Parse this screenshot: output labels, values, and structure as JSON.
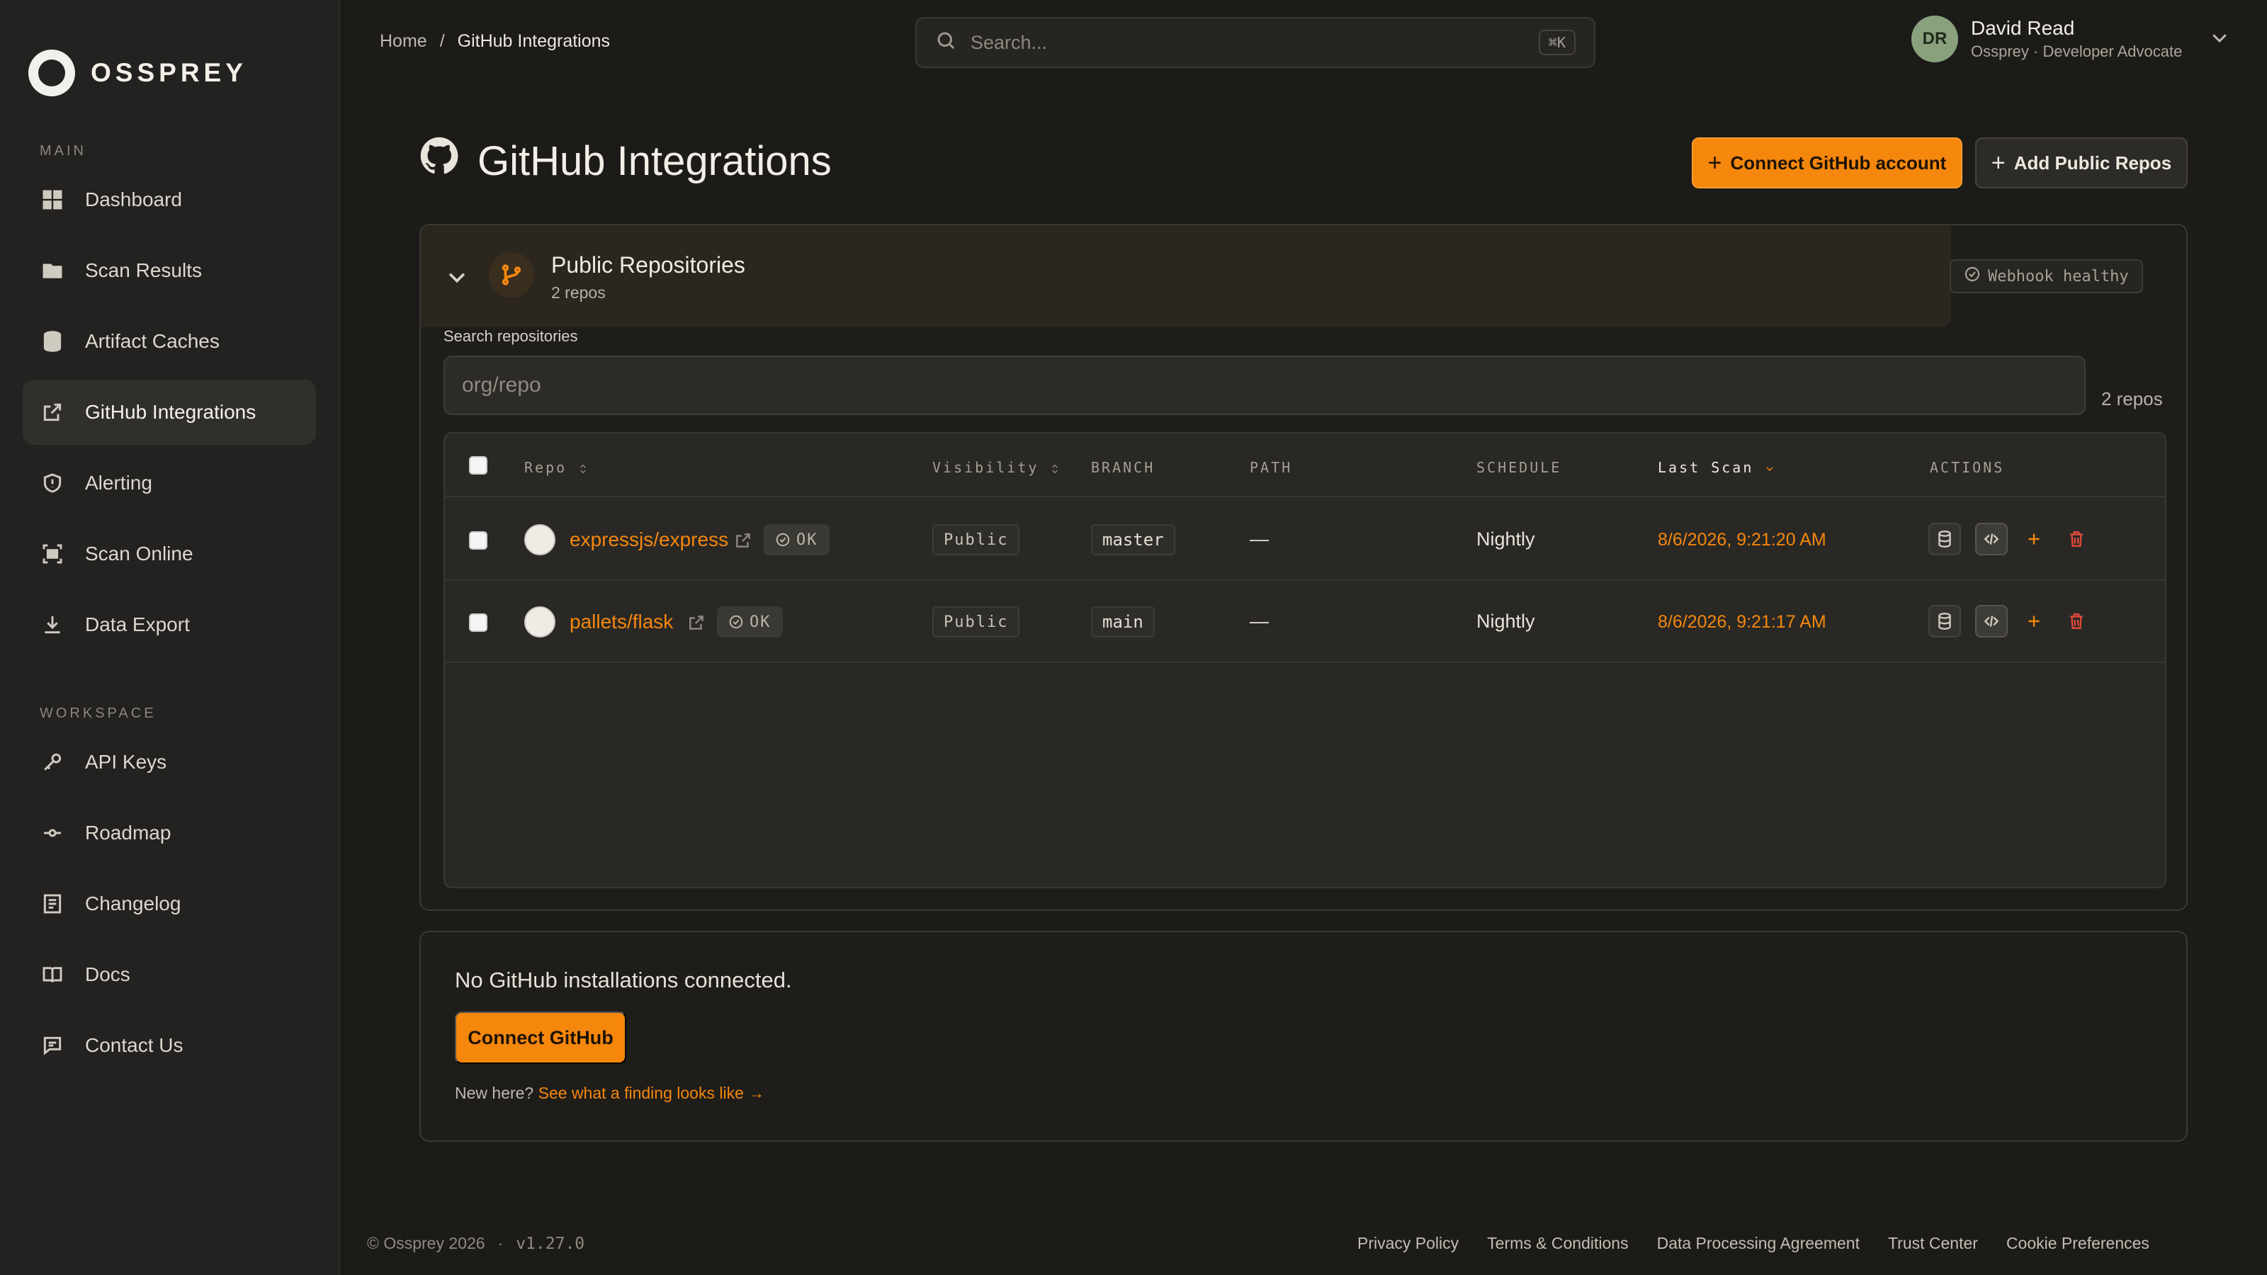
{
  "brand": {
    "name": "OSSPREY"
  },
  "sidebar": {
    "main_label": "MAIN",
    "workspace_label": "WORKSPACE",
    "main_items": [
      {
        "label": "Dashboard",
        "icon": "grid-icon"
      },
      {
        "label": "Scan Results",
        "icon": "folder-icon"
      },
      {
        "label": "Artifact Caches",
        "icon": "database-icon"
      },
      {
        "label": "GitHub Integrations",
        "icon": "external-link-icon",
        "active": true
      },
      {
        "label": "Alerting",
        "icon": "shield-icon"
      },
      {
        "label": "Scan Online",
        "icon": "scan-icon"
      },
      {
        "label": "Data Export",
        "icon": "download-icon"
      }
    ],
    "workspace_items": [
      {
        "label": "API Keys",
        "icon": "key-icon"
      },
      {
        "label": "Roadmap",
        "icon": "roadmap-icon"
      },
      {
        "label": "Changelog",
        "icon": "changelog-icon"
      },
      {
        "label": "Docs",
        "icon": "book-icon"
      },
      {
        "label": "Contact Us",
        "icon": "chat-icon"
      }
    ]
  },
  "breadcrumb": {
    "home": "Home",
    "sep": "/",
    "current": "GitHub Integrations"
  },
  "search": {
    "placeholder": "Search...",
    "shortcut": "⌘K"
  },
  "user": {
    "initials": "DR",
    "name": "David Read",
    "subtitle": "Ossprey · Developer Advocate"
  },
  "page": {
    "title": "GitHub Integrations",
    "connect_account_label": "Connect GitHub account",
    "add_public_label": "Add Public Repos"
  },
  "public_repos": {
    "title": "Public Repositories",
    "count_label": "2 repos",
    "webhook_status": "Webhook healthy",
    "search_label": "Search repositories",
    "search_placeholder": "org/repo",
    "result_count": "2 repos",
    "columns": {
      "repo": "Repo",
      "visibility": "Visibility",
      "branch": "BRANCH",
      "path": "PATH",
      "schedule": "SCHEDULE",
      "last_scan": "Last Scan",
      "actions": "ACTIONS"
    },
    "rows": [
      {
        "repo": "expressjs/express",
        "status": "OK",
        "visibility": "Public",
        "branch": "master",
        "path": "—",
        "schedule": "Nightly",
        "last_scan": "8/6/2026, 9:21:20 AM"
      },
      {
        "repo": "pallets/flask",
        "status": "OK",
        "visibility": "Public",
        "branch": "main",
        "path": "—",
        "schedule": "Nightly",
        "last_scan": "8/6/2026, 9:21:17 AM"
      }
    ]
  },
  "installations": {
    "empty_text": "No GitHub installations connected.",
    "connect_label": "Connect GitHub",
    "new_here": "New here?",
    "finding_link": "See what a finding looks like →"
  },
  "footer": {
    "copyright": "© Ossprey 2026",
    "dot": "·",
    "version": "v1.27.0",
    "links": [
      "Privacy Policy",
      "Terms & Conditions",
      "Data Processing Agreement",
      "Trust Center",
      "Cookie Preferences"
    ]
  },
  "colors": {
    "accent": "#f5870c",
    "background": "#1c1b18",
    "sidebar": "#232220"
  }
}
